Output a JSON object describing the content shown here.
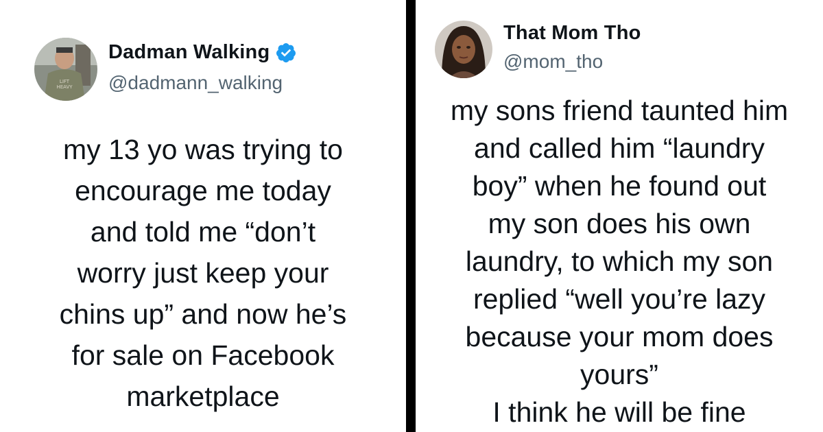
{
  "left_tweet": {
    "author_name": "Dadman Walking",
    "handle": "@dadmann_walking",
    "verified_icon": "verified-badge-icon",
    "avatar_icon": "profile-photo",
    "text": "my 13 yo was trying to\nencourage me today\nand told me “don’t\nworry just keep your\nchins up” and now he’s\nfor sale on Facebook\nmarketplace"
  },
  "right_tweet": {
    "author_name": "That Mom Tho",
    "handle": "@mom_tho",
    "avatar_icon": "profile-photo",
    "text": "my sons friend taunted him\nand called him “laundry\nboy” when he found out\nmy son does his own\nlaundry, to which my son\nreplied “well you’re lazy\nbecause your mom does\nyours”\nI think he will be fine"
  },
  "colors": {
    "divider": "#000000",
    "verified": "#1d9bf0",
    "handle": "#536471",
    "text": "#0f1419"
  }
}
